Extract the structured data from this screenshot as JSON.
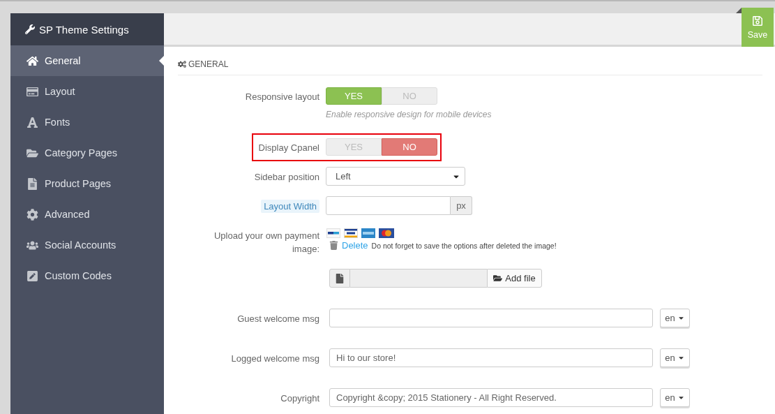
{
  "sidebar": {
    "title": "SP Theme Settings",
    "items": [
      {
        "label": "General",
        "selected": true
      },
      {
        "label": "Layout",
        "selected": false
      },
      {
        "label": "Fonts",
        "selected": false
      },
      {
        "label": "Category Pages",
        "selected": false
      },
      {
        "label": "Product Pages",
        "selected": false
      },
      {
        "label": "Advanced",
        "selected": false
      },
      {
        "label": "Social Accounts",
        "selected": false
      },
      {
        "label": "Custom Codes",
        "selected": false
      }
    ]
  },
  "toolbar": {
    "save_label": "Save"
  },
  "section": {
    "title": "GENERAL"
  },
  "fields": [
    {
      "kind": "toggle",
      "label": "Responsive layout",
      "label_tooltip": false,
      "highlighted": false,
      "options": [
        {
          "label": "YES",
          "selected": true
        },
        {
          "label": "NO",
          "selected": false
        }
      ],
      "help": "Enable responsive design for mobile devices"
    },
    {
      "kind": "toggle",
      "label": "Display Cpanel",
      "label_tooltip": false,
      "highlighted": true,
      "options": [
        {
          "label": "YES",
          "selected": false
        },
        {
          "label": "NO",
          "selected": true
        }
      ]
    },
    {
      "kind": "select",
      "label": "Sidebar position",
      "label_tooltip": false,
      "highlighted": false,
      "value": "Left"
    },
    {
      "kind": "unit_input",
      "label": "Layout Width",
      "label_tooltip": true,
      "highlighted": false,
      "unit": "px"
    },
    {
      "kind": "payment_image",
      "label": "Upload your own payment image:",
      "label_tooltip": false,
      "highlighted": false,
      "delete_link": "Delete",
      "note": "Do not forget to save the options after deleted the image!"
    },
    {
      "kind": "file_upload",
      "highlighted": false,
      "button": "Add file"
    },
    {
      "kind": "multilang_input",
      "label": "Guest welcome msg",
      "label_tooltip": false,
      "highlighted": false,
      "language": "en"
    },
    {
      "kind": "multilang_input",
      "label": "Logged welcome msg",
      "label_tooltip": false,
      "highlighted": false,
      "value": "Hi to our store!",
      "language": "en"
    },
    {
      "kind": "multilang_input",
      "label": "Copyright",
      "label_tooltip": false,
      "highlighted": false,
      "value": "Copyright &copy; 2015 Stationery - All Right Reserved.",
      "language": "en"
    }
  ]
}
